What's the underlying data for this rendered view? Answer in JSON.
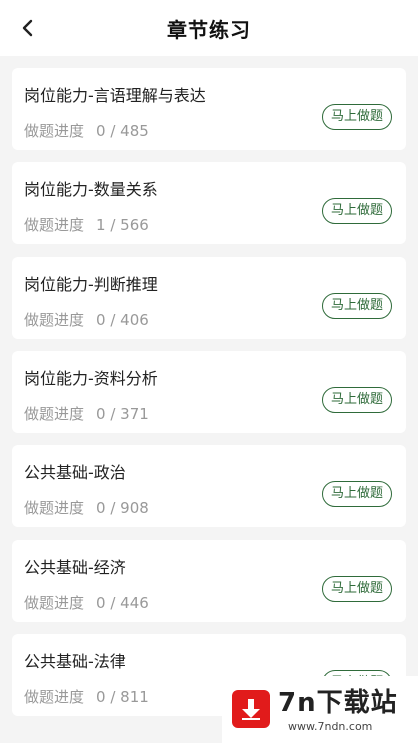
{
  "header": {
    "title": "章节练习",
    "back_icon": "chevron-left-icon"
  },
  "chapters": [
    {
      "title": "岗位能力-言语理解与表达",
      "progress_label": "做题进度",
      "progress": "0 / 485",
      "button": "马上做题"
    },
    {
      "title": "岗位能力-数量关系",
      "progress_label": "做题进度",
      "progress": "1 / 566",
      "button": "马上做题"
    },
    {
      "title": "岗位能力-判断推理",
      "progress_label": "做题进度",
      "progress": "0 / 406",
      "button": "马上做题"
    },
    {
      "title": "岗位能力-资料分析",
      "progress_label": "做题进度",
      "progress": "0 / 371",
      "button": "马上做题"
    },
    {
      "title": "公共基础-政治",
      "progress_label": "做题进度",
      "progress": "0 / 908",
      "button": "马上做题"
    },
    {
      "title": "公共基础-经济",
      "progress_label": "做题进度",
      "progress": "0 / 446",
      "button": "马上做题"
    },
    {
      "title": "公共基础-法律",
      "progress_label": "做题进度",
      "progress": "0 / 811",
      "button": "马上做题"
    }
  ],
  "watermark": {
    "brand": "7n下载站",
    "url": "www.7ndn.com",
    "logo_color": "#e11b1b"
  },
  "colors": {
    "accent": "#2f6b3a",
    "background": "#f4f4f4",
    "muted_text": "#999999"
  }
}
